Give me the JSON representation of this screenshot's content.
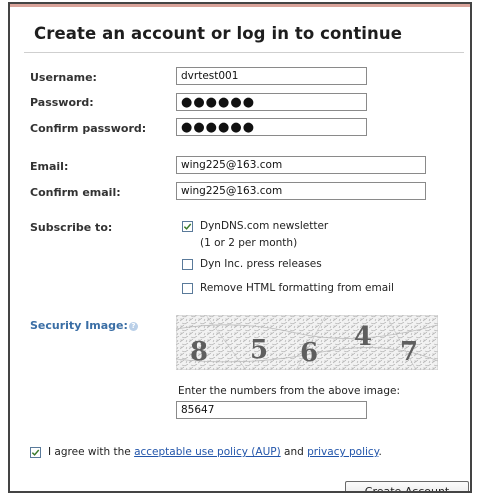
{
  "form": {
    "title": "Create an account or log in to continue",
    "username": {
      "label": "Username:",
      "value": "dvrtest001"
    },
    "password": {
      "label": "Password:",
      "value": "●●●●●●"
    },
    "confirm_password": {
      "label": "Confirm password:",
      "value": "●●●●●●"
    },
    "email": {
      "label": "Email:",
      "value": "wing225@163.com"
    },
    "confirm_email": {
      "label": "Confirm email:",
      "value": "wing225@163.com"
    },
    "subscribe": {
      "label": "Subscribe to:",
      "options": [
        {
          "label": "DynDNS.com newsletter",
          "note": "(1 or 2 per month)",
          "checked": true
        },
        {
          "label": "Dyn Inc. press releases",
          "checked": false
        },
        {
          "label": "Remove HTML formatting from email",
          "checked": false
        }
      ]
    },
    "security": {
      "label": "Security Image:",
      "help_icon": "question-icon",
      "captcha_digits": [
        "8",
        "5",
        "6",
        "4",
        "7"
      ],
      "instruction": "Enter the numbers from the above image:",
      "value": "85647"
    },
    "agree": {
      "checked": true,
      "text_before": "I agree with the",
      "aup_link": "acceptable use policy (AUP)",
      "text_middle": "and",
      "privacy_link": "privacy policy",
      "text_after": "."
    },
    "submit_label": "Create Account"
  },
  "colors": {
    "accent_bar": "#d9a39a",
    "label": "#333333",
    "security_label": "#3a6ea5",
    "link": "#2255aa",
    "frame_border": "#444444"
  }
}
